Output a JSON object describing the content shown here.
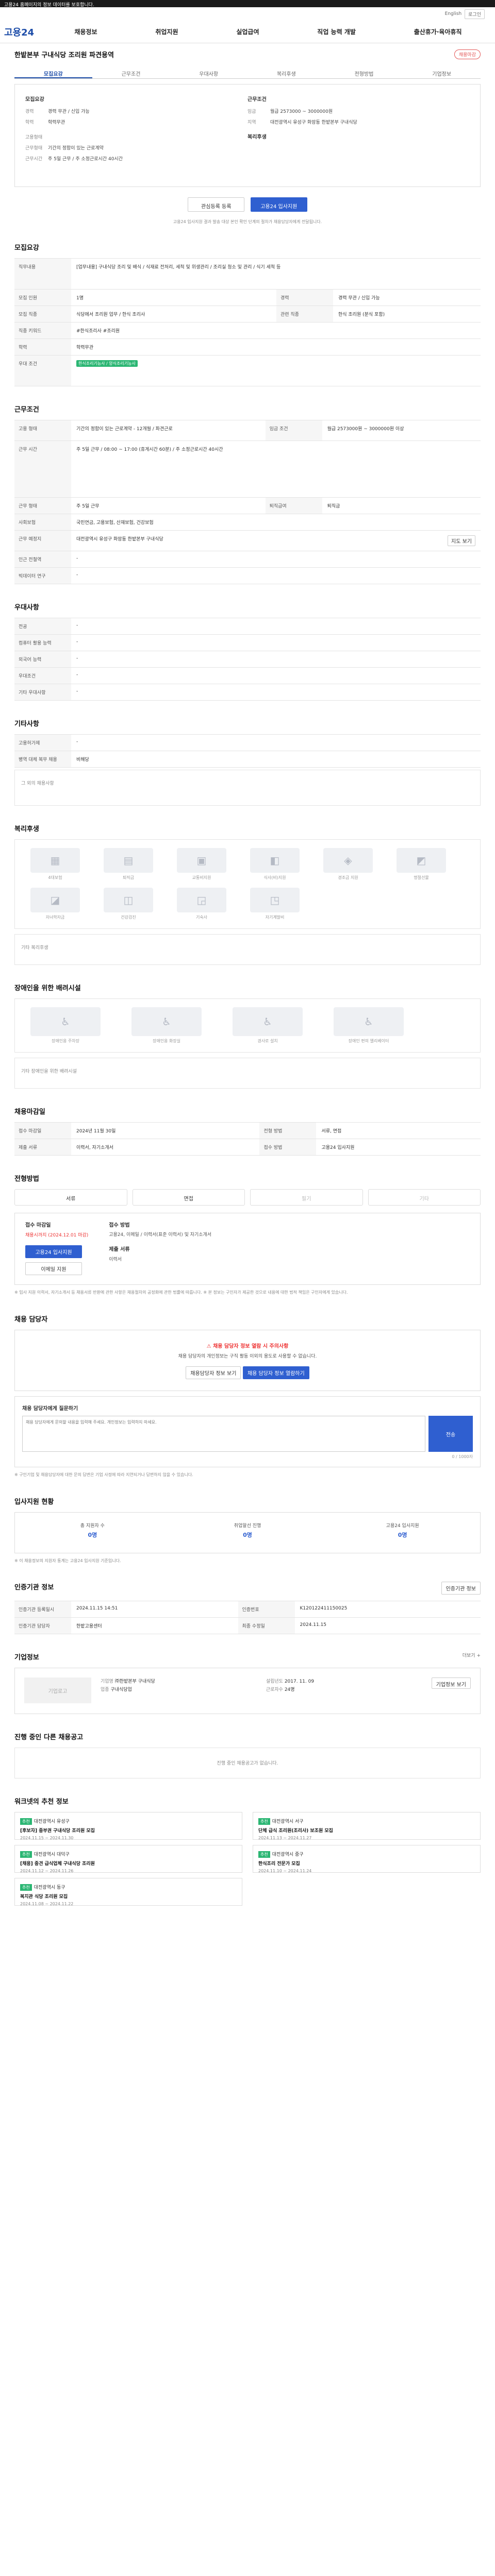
{
  "top_banner": "고용24 홈페이지의 정보 데이터를 보호합니다.",
  "util": {
    "lang": "English",
    "login_label": "로그인"
  },
  "gnb": {
    "logo": "고용24",
    "menus": [
      "채용정보",
      "취업지원",
      "실업급여",
      "직업 능력 개발",
      "출산휴가·육아휴직"
    ]
  },
  "title": "한밭본부 구내식당 조리원 파견용역",
  "badge_label": "채용마감",
  "tabs": [
    "모집요강",
    "근무조건",
    "우대사항",
    "복리후생",
    "전형방법",
    "기업정보"
  ],
  "summary": {
    "left_head": "모집요강",
    "left_rows": [
      {
        "k": "경력",
        "v": "경력 무관 / 신입 가능"
      },
      {
        "k": "학력",
        "v": "학력무관"
      },
      {
        "k": "고용형태",
        "v": ""
      },
      {
        "k": "근무형태",
        "v": "기간의 정함이 있는 근로계약"
      },
      {
        "k": "근무시간",
        "v": "주 5일 근무 / 주 소정근로시간 40시간"
      }
    ],
    "right_head": "근무조건",
    "right_rows": [
      {
        "k": "임금",
        "v": "월급 2573000 ~ 3000000원"
      },
      {
        "k": "지역",
        "v": "대전광역시 유성구 화암동 한밭본부 구내식당"
      }
    ],
    "right_head2": "복리후생",
    "btn_scrap": "관심등록 등록",
    "btn_apply": "고용24 입사지원",
    "note": "고용24 입사지원 결과 발송 대상 본인 확인 단계의 절차가 채용담당자에게 전달됩니다."
  },
  "sec_recruit": {
    "title": "모집요강",
    "rows": [
      {
        "k": "직무내용",
        "v": "[업무내용] 구내식당 조리 및 배식 / 식재료 전처리, 세척 및 위생관리 / 조리실 청소 및 관리 / 식기 세척 등"
      },
      {
        "k": "모집 인원",
        "v": "1명"
      },
      {
        "k": "모집 직종",
        "v": "식당에서 조리원 업무 / 한식 조리사"
      },
      {
        "k": "직종 키워드",
        "v": "#한식조리사 #조리원"
      },
      {
        "k": "관련 직종",
        "v": "한식 조리원 (분식 포함)"
      },
      {
        "k": "경력",
        "v": "경력 무관 / 신입 가능"
      },
      {
        "k": "학력",
        "v": "학력무관"
      },
      {
        "k": "우대 조건",
        "v": "한식조리기능사 / 양식조리기능사"
      }
    ]
  },
  "sec_work": {
    "title": "근무조건",
    "rows": [
      {
        "k": "고용 형태",
        "v": "기간의 정함이 있는 근로계약 - 12개월 / 파견근로"
      },
      {
        "k": "임금 조건",
        "v": "월급 2573000원 ~ 3000000원 이상"
      },
      {
        "k": "근무 시간",
        "v": "주 5일 근무 / 08:00 ~ 17:00 (휴게시간 60분) / 주 소정근로시간 40시간"
      },
      {
        "k": "근무 형태",
        "v": "주 5일 근무"
      },
      {
        "k": "사회보험",
        "v": "국민연금, 고용보험, 산재보험, 건강보험"
      },
      {
        "k": "퇴직급여",
        "v": "퇴직금"
      },
      {
        "k": "근무 예정지",
        "v": "대전광역시 유성구 화암동 한밭본부 구내식당"
      },
      {
        "k": "인근 전철역",
        "v": "-"
      },
      {
        "k": "빅데이터 연구",
        "v": "-"
      }
    ],
    "btn_map": "지도 보기"
  },
  "sec_pref": {
    "title": "우대사항",
    "rows": [
      {
        "k": "전공",
        "v": "-"
      },
      {
        "k": "컴퓨터 활용 능력",
        "v": "-"
      },
      {
        "k": "외국어 능력",
        "v": "-"
      },
      {
        "k": "우대조건",
        "v": "-"
      },
      {
        "k": "기타 우대사항",
        "v": "-"
      }
    ]
  },
  "sec_etc": {
    "title": "기타사항",
    "rows": [
      {
        "k": "고용허가제",
        "v": "-"
      },
      {
        "k": "병역 대체 복무 채용",
        "v": "비해당"
      }
    ],
    "empty": "그 외의 채용사항"
  },
  "sec_welfare": {
    "title": "복리후생",
    "items": [
      "4대보험",
      "퇴직금",
      "교통비지원",
      "식사(비)지원",
      "경조금 지원",
      "명절선물",
      "자녀학자금",
      "건강검진",
      "기숙사",
      "자기계발비"
    ],
    "empty": "기타 복리후생"
  },
  "sec_disabled": {
    "title": "장애인을 위한 배려시설",
    "items": [
      "장애인용 주차장",
      "장애인용 화장실",
      "경사로 설치",
      "장애인 편의 엘리베이터"
    ],
    "empty": "기타 장애인을 위한 배려시설"
  },
  "sec_process": {
    "title": "채용마감일",
    "rows": [
      {
        "k": "접수 마감일",
        "v": "2024년 11월 30일"
      },
      {
        "k": "전형 방법",
        "v": "서류, 면접"
      },
      {
        "k": "제출 서류",
        "v": "이력서, 자기소개서"
      },
      {
        "k": "접수 방법",
        "v": "고용24 입사지원"
      }
    ]
  },
  "sec_method": {
    "title": "전형방법",
    "steps": [
      "서류",
      "면접",
      "필기",
      "기타"
    ],
    "apply_head": "접수 마감일",
    "apply_date": "채용시까지 (2024.12.01 마감)",
    "apply_btn": "고용24 입사지원",
    "email_btn": "이메일 지원",
    "docs_head": "접수 방법",
    "docs_text": "고용24, 이메일 / 이력서(표준 이력서) 및 자기소개서",
    "docs_head2": "제출 서류",
    "docs_text2": "이력서",
    "notices": "※ 입사 지원 이력서, 자기소개서 등 채용서류 반환에 관한 사항은 채용절차의 공정화에 관한 법률에 따릅니다. ※ 본 정보는 구인자가 제공한 것으로 내용에 대한 법적 책임은 구인자에게 있습니다."
  },
  "sec_contact": {
    "title": "채용 담당자",
    "warn": "채용 담당자 정보 열람 시 주의사항",
    "text": "채용 담당자의 개인정보는 구직 활동 이외의 용도로 사용할 수 없습니다.",
    "btn1": "채용담당자 정보 보기",
    "btn2": "채용 담당자 정보 열람하기",
    "q_label": "채용 담당자에게 질문하기",
    "q_placeholder": "채용 담당자에게 문의할 내용을 입력해 주세요. 개인정보는 입력하지 마세요.",
    "q_send": "전송",
    "q_count": "0 / 1000자",
    "notes": "※ 구인기업 및 채용담당자에 대한 문의 답변은 기업 사정에 따라 지연되거나 답변하지 않을 수 있습니다."
  },
  "sec_stats": {
    "title": "입사지원 현황",
    "items": [
      {
        "label": "총 지원자 수",
        "value": "0명"
      },
      {
        "label": "취업알선 진행",
        "value": "0명"
      },
      {
        "label": "고용24 입사지원",
        "value": "0명"
      }
    ],
    "note": "※ 이 채용정보의 지원자 통계는 고용24 입사지원 기준입니다."
  },
  "sec_org": {
    "title": "인증기관 정보",
    "btn": "인증기관 정보",
    "rows": [
      {
        "k": "인증기관 등록일시",
        "v": "2024.11.15 14:51"
      },
      {
        "k": "인증번호",
        "v": "K120122411150025"
      },
      {
        "k": "인증기관 담당자",
        "v": "한밭고용센터"
      },
      {
        "k": "최종 수정일",
        "v": "2024.11.15"
      }
    ]
  },
  "sec_corp": {
    "title": "기업정보",
    "more": "더보기 +",
    "logo": "기업로고",
    "rows": [
      {
        "k": "기업명",
        "v": "㈜한밭본부 구내식당"
      },
      {
        "k": "업종",
        "v": "구내식당업"
      },
      {
        "k": "설립년도",
        "v": "2017. 11. 09"
      },
      {
        "k": "근로자수",
        "v": "24명"
      }
    ],
    "btn": "기업정보 보기"
  },
  "sec_similar": {
    "title": "진행 중인 다른 채용공고",
    "empty": "진행 중인 채용공고가 없습니다."
  },
  "sec_ads": {
    "title": "워크넷의 추천 정보",
    "items": [
      {
        "badge": "추천",
        "org": "대전광역시 유성구",
        "title": "[후보자] 중부권 구내식당 조리원 모집",
        "sub": "2024.11.15 ~ 2024.11.30"
      },
      {
        "badge": "추천",
        "org": "대전광역시 서구",
        "title": "단체 급식 조리원(조리사) 보조원 모집",
        "sub": "2024.11.13 ~ 2024.11.27"
      },
      {
        "badge": "추천",
        "org": "대전광역시 대덕구",
        "title": "[채용] 중견 급식업체 구내식당 조리원",
        "sub": "2024.11.12 ~ 2024.11.26"
      },
      {
        "badge": "추천",
        "org": "대전광역시 중구",
        "title": "한식조리 전문가 모집",
        "sub": "2024.11.10 ~ 2024.11.24"
      },
      {
        "badge": "추천",
        "org": "대전광역시 동구",
        "title": "복지관 식당 조리원 모집",
        "sub": "2024.11.08 ~ 2024.11.22"
      }
    ]
  }
}
